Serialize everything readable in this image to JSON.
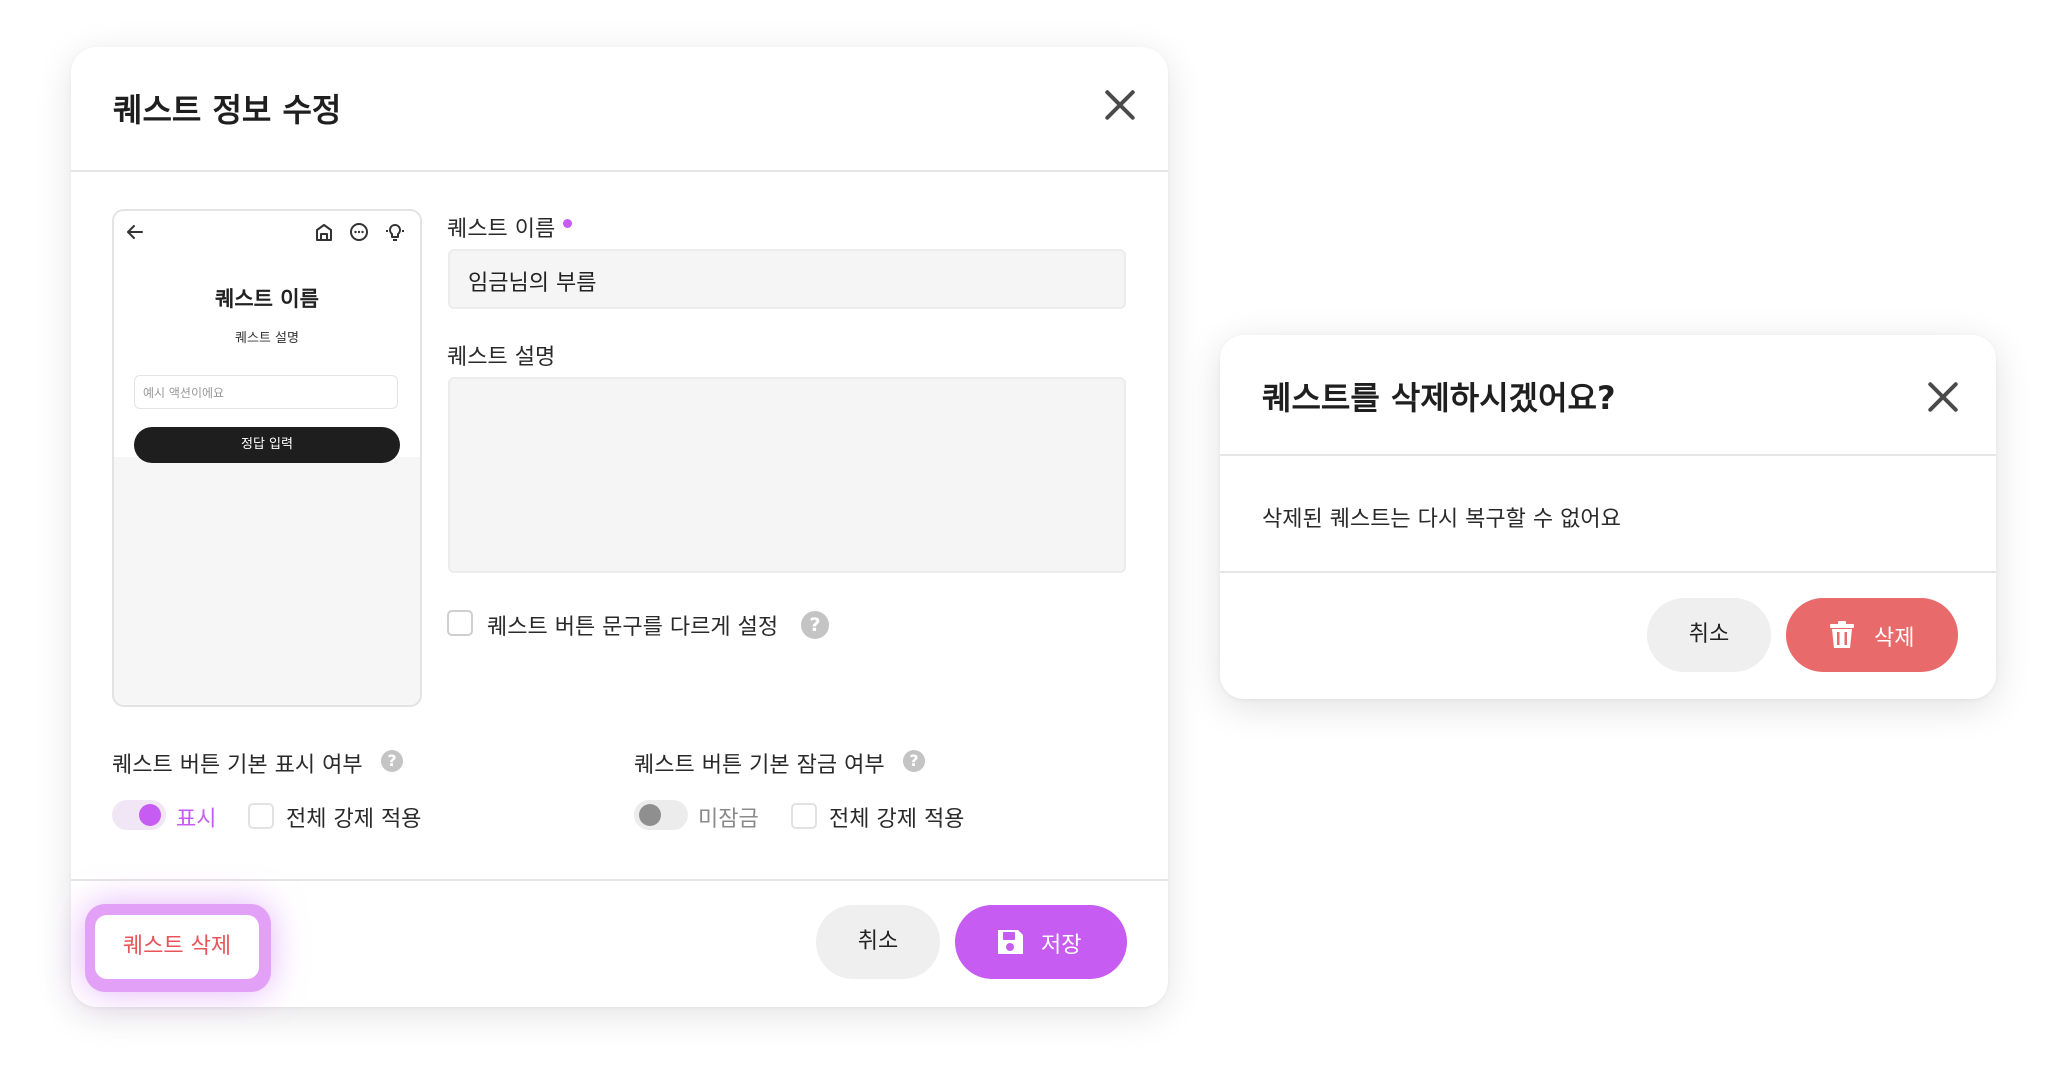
{
  "edit_modal": {
    "title": "퀘스트 정보 수정",
    "preview": {
      "quest_title": "퀘스트 이름",
      "quest_description": "퀘스트 설명",
      "input_placeholder": "예시 액션이에요",
      "submit_label": "정답 입력"
    },
    "name_label": "퀘스트 이름",
    "name_value": "임금님의 부름",
    "description_label": "퀘스트 설명",
    "description_value": "",
    "custom_button_text_label": "퀘스트 버튼 문구를 다르게 설정",
    "default_visibility": {
      "label": "퀘스트 버튼 기본 표시 여부",
      "toggle_label": "표시",
      "toggle_on": true,
      "force_label": "전체 강제 적용"
    },
    "default_lock": {
      "label": "퀘스트 버튼 기본 잠금 여부",
      "toggle_label": "미잠금",
      "toggle_on": false,
      "force_label": "전체 강제 적용"
    },
    "delete_label": "퀘스트 삭제",
    "cancel_label": "취소",
    "save_label": "저장"
  },
  "confirm_dialog": {
    "title": "퀘스트를 삭제하시겠어요?",
    "message": "삭제된 퀘스트는 다시 복구할 수 없어요",
    "cancel_label": "취소",
    "delete_label": "삭제"
  },
  "icons": [
    "close-icon",
    "back-arrow-icon",
    "home-icon",
    "chat-icon",
    "hint-bulb-icon",
    "help-icon",
    "save-disk-icon",
    "trash-icon"
  ],
  "colors": {
    "accent": "#c65cf1",
    "danger": "#e96a6b",
    "danger_text": "#e8545a",
    "neutral_button": "#efefef"
  }
}
